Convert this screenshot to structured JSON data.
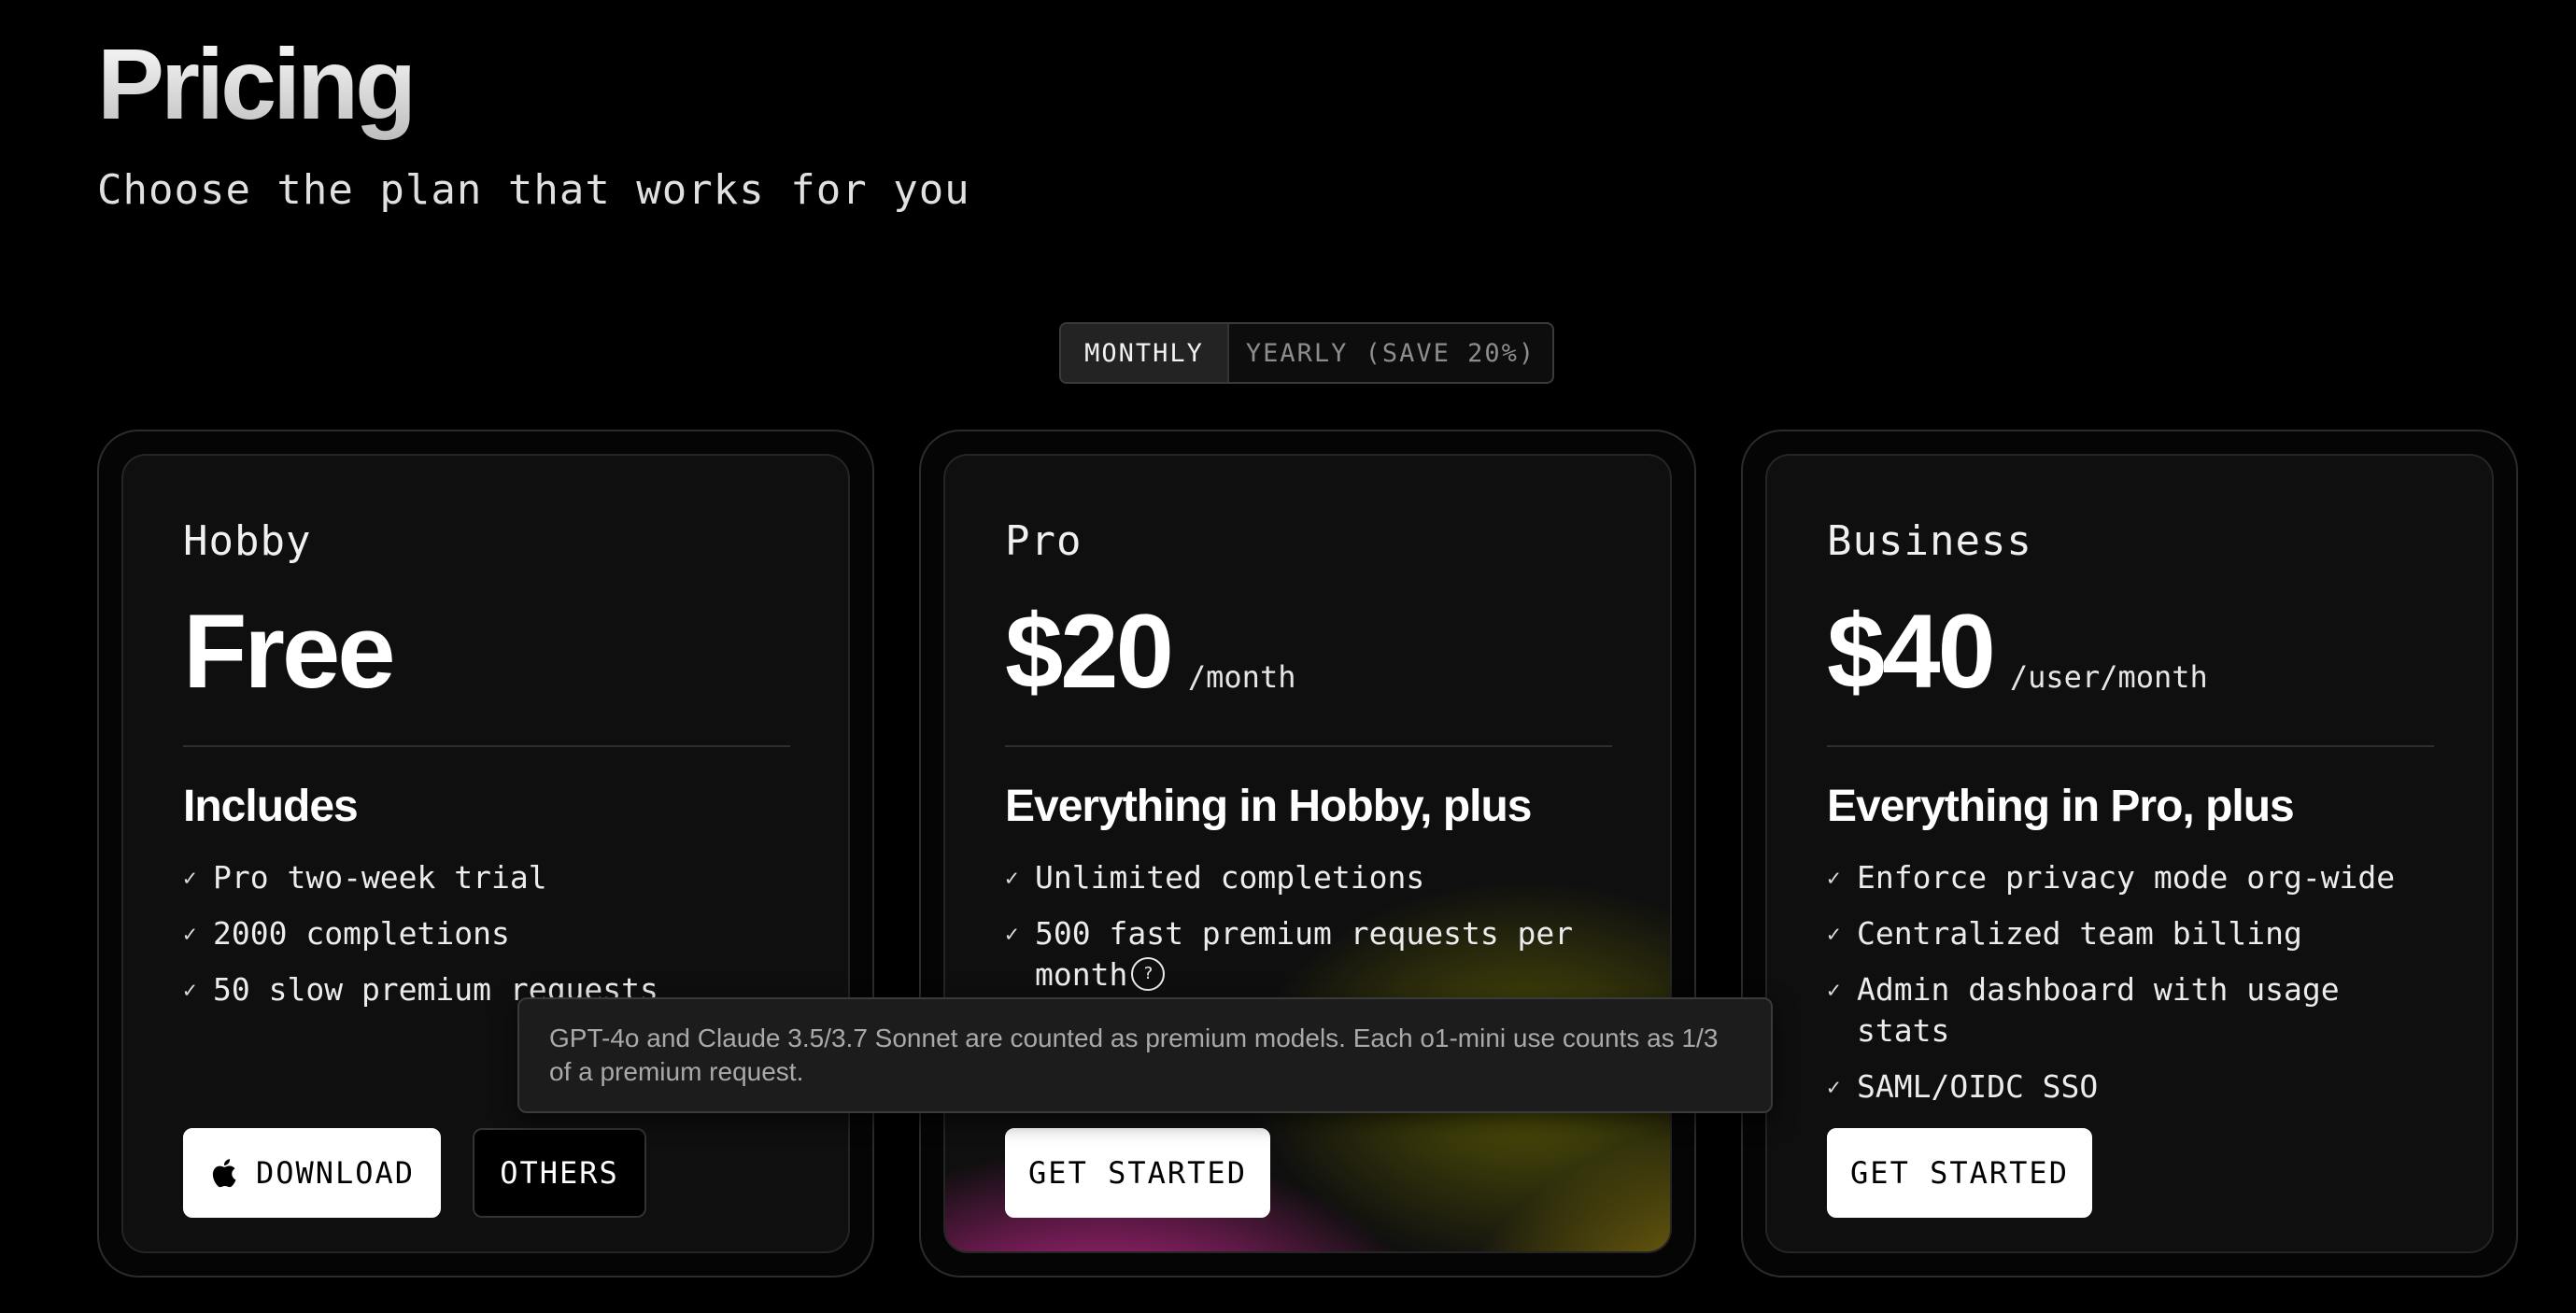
{
  "header": {
    "title": "Pricing",
    "subtitle": "Choose the plan that works for you"
  },
  "billing_toggle": {
    "monthly_label": "MONTHLY",
    "yearly_label": "YEARLY (SAVE 20%)",
    "selected": "MONTHLY"
  },
  "plans": [
    {
      "name": "Hobby",
      "price": "Free",
      "price_unit": "",
      "includes_heading": "Includes",
      "features": [
        "Pro two-week trial",
        "2000 completions",
        "50 slow premium requests"
      ],
      "primary_button": "DOWNLOAD",
      "secondary_button": "OTHERS"
    },
    {
      "name": "Pro",
      "price": "$20",
      "price_unit": "/month",
      "includes_heading": "Everything in Hobby, plus",
      "features": [
        "Unlimited completions",
        "500 fast premium requests per month"
      ],
      "primary_button": "GET STARTED"
    },
    {
      "name": "Business",
      "price": "$40",
      "price_unit": "/user/month",
      "includes_heading": "Everything in Pro, plus",
      "features": [
        "Enforce privacy mode org-wide",
        "Centralized team billing",
        "Admin dashboard with usage stats",
        "SAML/OIDC SSO"
      ],
      "primary_button": "GET STARTED"
    }
  ],
  "tooltip": {
    "text": "GPT-4o and Claude 3.5/3.7 Sonnet are counted as premium models. Each o1-mini use counts as 1/3 of a premium request."
  },
  "icons": {
    "check": "check-icon",
    "help": "question-circle-icon",
    "apple": "apple-icon"
  },
  "colors": {
    "background": "#000000",
    "card_background": "#0f0f0f",
    "pro_glow_pink": "#eb32aa",
    "pro_glow_yellow": "#e6be14"
  }
}
